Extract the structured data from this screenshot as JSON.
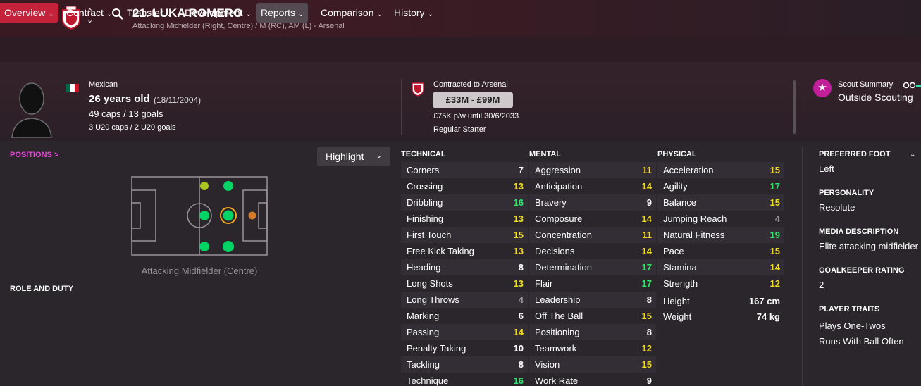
{
  "header": {
    "back_icon": "arrow-left-icon",
    "forward_icon": "arrow-right-icon",
    "title": "21. LUKA ROMERO",
    "subtitle": "Attacking Midfielder (Right, Centre) / M (RC), AM (L) - Arsenal"
  },
  "menu": [
    {
      "label": "Overview"
    },
    {
      "label": "Contract"
    },
    {
      "label": "Transfer"
    },
    {
      "label": "Development"
    },
    {
      "label": "Reports"
    },
    {
      "label": "Comparison"
    },
    {
      "label": "History"
    }
  ],
  "profile": {
    "nationality": "Mexican",
    "age": "26 years old",
    "dob": "(18/11/2004)",
    "caps": "49 caps / 13 goals",
    "u20_caps": "3 U20 caps / 2 U20 goals",
    "contract": "Contracted to Arsenal",
    "value": "£33M - £99M",
    "wage": "£75K p/w until 30/6/2033",
    "squad_status": "Regular Starter",
    "scout_title": "Scout Summary",
    "scout_text": "Outside Scouting"
  },
  "positions": {
    "link": "POSITIONS >",
    "highlight": "Highlight",
    "label": "Attacking Midfielder (Centre)",
    "role_duty": "ROLE AND DUTY"
  },
  "colors": {
    "high": "#2ee86a",
    "good": "#9fdc2e",
    "mid": "#f0dc1e",
    "low": "#ffffff",
    "weak": "#9a9499",
    "natural": "#00d464",
    "accomplished": "#a8c41e",
    "unconvincing": "#d17b2a"
  },
  "technical": {
    "heading": "TECHNICAL",
    "rows": [
      {
        "name": "Corners",
        "value": "7"
      },
      {
        "name": "Crossing",
        "value": "13"
      },
      {
        "name": "Dribbling",
        "value": "16"
      },
      {
        "name": "Finishing",
        "value": "13"
      },
      {
        "name": "First Touch",
        "value": "15"
      },
      {
        "name": "Free Kick Taking",
        "value": "13"
      },
      {
        "name": "Heading",
        "value": "8"
      },
      {
        "name": "Long Shots",
        "value": "13"
      },
      {
        "name": "Long Throws",
        "value": "4"
      },
      {
        "name": "Marking",
        "value": "6"
      },
      {
        "name": "Passing",
        "value": "14"
      },
      {
        "name": "Penalty Taking",
        "value": "10"
      },
      {
        "name": "Tackling",
        "value": "8"
      },
      {
        "name": "Technique",
        "value": "16"
      }
    ]
  },
  "mental": {
    "heading": "MENTAL",
    "rows": [
      {
        "name": "Aggression",
        "value": "11"
      },
      {
        "name": "Anticipation",
        "value": "14"
      },
      {
        "name": "Bravery",
        "value": "9"
      },
      {
        "name": "Composure",
        "value": "14"
      },
      {
        "name": "Concentration",
        "value": "11"
      },
      {
        "name": "Decisions",
        "value": "14"
      },
      {
        "name": "Determination",
        "value": "17"
      },
      {
        "name": "Flair",
        "value": "17"
      },
      {
        "name": "Leadership",
        "value": "8"
      },
      {
        "name": "Off The Ball",
        "value": "15"
      },
      {
        "name": "Positioning",
        "value": "8"
      },
      {
        "name": "Teamwork",
        "value": "12"
      },
      {
        "name": "Vision",
        "value": "15"
      },
      {
        "name": "Work Rate",
        "value": "9"
      }
    ]
  },
  "physical": {
    "heading": "PHYSICAL",
    "rows": [
      {
        "name": "Acceleration",
        "value": "15"
      },
      {
        "name": "Agility",
        "value": "17"
      },
      {
        "name": "Balance",
        "value": "15"
      },
      {
        "name": "Jumping Reach",
        "value": "4"
      },
      {
        "name": "Natural Fitness",
        "value": "19"
      },
      {
        "name": "Pace",
        "value": "15"
      },
      {
        "name": "Stamina",
        "value": "14"
      },
      {
        "name": "Strength",
        "value": "12"
      }
    ],
    "height_label": "Height",
    "height": "167 cm",
    "weight_label": "Weight",
    "weight": "74 kg"
  },
  "sidebar": {
    "foot_head": "PREFERRED FOOT",
    "foot": "Left",
    "personality_head": "PERSONALITY",
    "personality": "Resolute",
    "media_head": "MEDIA DESCRIPTION",
    "media": "Elite attacking midfielder",
    "gk_head": "GOALKEEPER RATING",
    "gk": "2",
    "traits_head": "PLAYER TRAITS",
    "trait1": "Plays One-Twos",
    "trait2": "Runs With Ball Often"
  }
}
